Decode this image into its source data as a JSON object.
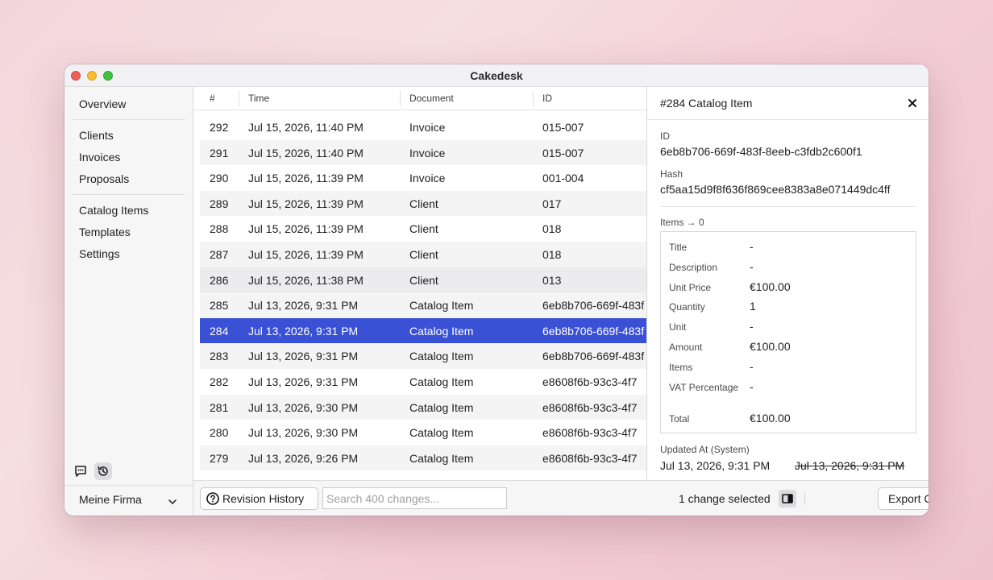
{
  "window": {
    "title": "Cakedesk"
  },
  "sidebar": {
    "items": [
      {
        "label": "Overview"
      },
      {
        "label": "Clients"
      },
      {
        "label": "Invoices"
      },
      {
        "label": "Proposals"
      },
      {
        "label": "Catalog Items"
      },
      {
        "label": "Templates"
      },
      {
        "label": "Settings"
      }
    ],
    "company": "Meine Firma"
  },
  "table": {
    "columns": [
      "#",
      "Time",
      "Document",
      "ID"
    ],
    "rows": [
      {
        "num": "292",
        "time": "Jul 15, 2026, 11:40 PM",
        "doc": "Invoice",
        "id": "015-007"
      },
      {
        "num": "291",
        "time": "Jul 15, 2026, 11:40 PM",
        "doc": "Invoice",
        "id": "015-007"
      },
      {
        "num": "290",
        "time": "Jul 15, 2026, 11:39 PM",
        "doc": "Invoice",
        "id": "001-004"
      },
      {
        "num": "289",
        "time": "Jul 15, 2026, 11:39 PM",
        "doc": "Client",
        "id": "017"
      },
      {
        "num": "288",
        "time": "Jul 15, 2026, 11:39 PM",
        "doc": "Client",
        "id": "018"
      },
      {
        "num": "287",
        "time": "Jul 15, 2026, 11:39 PM",
        "doc": "Client",
        "id": "018"
      },
      {
        "num": "286",
        "time": "Jul 15, 2026, 11:38 PM",
        "doc": "Client",
        "id": "013"
      },
      {
        "num": "285",
        "time": "Jul 13, 2026, 9:31 PM",
        "doc": "Catalog Item",
        "id": "6eb8b706-669f-483f"
      },
      {
        "num": "284",
        "time": "Jul 13, 2026, 9:31 PM",
        "doc": "Catalog Item",
        "id": "6eb8b706-669f-483f"
      },
      {
        "num": "283",
        "time": "Jul 13, 2026, 9:31 PM",
        "doc": "Catalog Item",
        "id": "6eb8b706-669f-483f"
      },
      {
        "num": "282",
        "time": "Jul 13, 2026, 9:31 PM",
        "doc": "Catalog Item",
        "id": "e8608f6b-93c3-4f7"
      },
      {
        "num": "281",
        "time": "Jul 13, 2026, 9:30 PM",
        "doc": "Catalog Item",
        "id": "e8608f6b-93c3-4f7"
      },
      {
        "num": "280",
        "time": "Jul 13, 2026, 9:30 PM",
        "doc": "Catalog Item",
        "id": "e8608f6b-93c3-4f7"
      },
      {
        "num": "279",
        "time": "Jul 13, 2026, 9:26 PM",
        "doc": "Catalog Item",
        "id": "e8608f6b-93c3-4f7"
      }
    ],
    "selected_num": "284"
  },
  "detail": {
    "title": "#284 Catalog Item",
    "id_label": "ID",
    "id_value": "6eb8b706-669f-483f-8eeb-c3fdb2c600f1",
    "hash_label": "Hash",
    "hash_value": "cf5aa15d9f8f636f869cee8383a8e071449dc4ff",
    "items_label": "Items → 0",
    "fields": [
      {
        "key": "Title",
        "value": "-"
      },
      {
        "key": "Description",
        "value": "-"
      },
      {
        "key": "Unit Price",
        "value": "€100.00"
      },
      {
        "key": "Quantity",
        "value": "1"
      },
      {
        "key": "Unit",
        "value": "-"
      },
      {
        "key": "Amount",
        "value": "€100.00"
      },
      {
        "key": "Items",
        "value": "-"
      },
      {
        "key": "VAT Percentage",
        "value": "-"
      },
      {
        "key": "Total",
        "value": "€100.00"
      }
    ],
    "updated_label": "Updated At (System)",
    "updated_new": "Jul 13, 2026, 9:31 PM",
    "updated_old": "Jul 13, 2026, 9:31 PM"
  },
  "footer": {
    "revision_button": "Revision History",
    "search_placeholder": "Search 400 changes...",
    "status": "1 change selected",
    "export_button": "Export CSV..."
  },
  "colors": {
    "selection": "#3a51d6",
    "close_red": "#ee5f57",
    "minimize_yellow": "#f6bd2f",
    "maximize_green": "#3fc43f"
  }
}
